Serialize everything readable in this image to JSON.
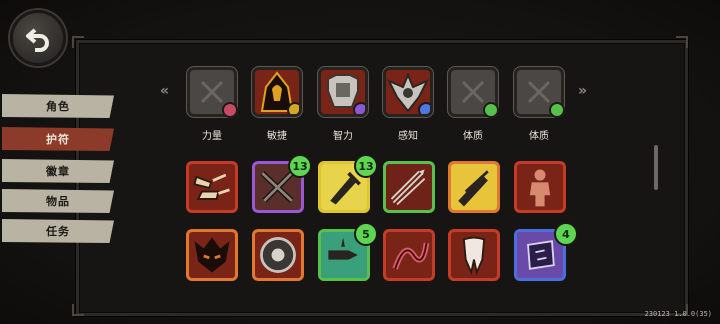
{
  "nav": {
    "back_icon": "back-arrow-icon",
    "tabs": [
      {
        "label": "角色",
        "active": false
      },
      {
        "label": "护符",
        "active": true
      },
      {
        "label": "徽章",
        "active": false
      },
      {
        "label": "物品",
        "active": false
      },
      {
        "label": "任务",
        "active": false
      }
    ]
  },
  "equip_slots": [
    {
      "label": "力量",
      "state": "empty",
      "badge_color": "#c94a63"
    },
    {
      "label": "敏捷",
      "state": "filled",
      "badge_color": "#d4a726"
    },
    {
      "label": "智力",
      "state": "filled",
      "badge_color": "#8a58d6"
    },
    {
      "label": "感知",
      "state": "filled",
      "badge_color": "#4c78e0"
    },
    {
      "label": "体质",
      "state": "empty",
      "badge_color": "#58c14c"
    },
    {
      "label": "体质",
      "state": "empty",
      "badge_color": "#58c14c"
    }
  ],
  "relics": [
    {
      "icon": "claw-hands-icon",
      "rarity": "red",
      "count": null
    },
    {
      "icon": "crossed-rifles-icon",
      "rarity": "purple",
      "count": "13"
    },
    {
      "icon": "sword-hilt-icon",
      "rarity": "yellow",
      "count": "13"
    },
    {
      "icon": "arrow-bundle-icon",
      "rarity": "green",
      "count": null
    },
    {
      "icon": "twin-daggers-icon",
      "rarity": "orange",
      "count": null
    },
    {
      "icon": "humanoid-figure-icon",
      "rarity": "red",
      "count": null
    },
    {
      "icon": "demon-mask-icon",
      "rarity": "orange",
      "count": null
    },
    {
      "icon": "ward-medallion-icon",
      "rarity": "orange",
      "count": null
    },
    {
      "icon": "bullet-icon",
      "rarity": "green",
      "count": "5"
    },
    {
      "icon": "tentacle-icon",
      "rarity": "red",
      "count": null
    },
    {
      "icon": "fang-icon",
      "rarity": "red",
      "count": null
    },
    {
      "icon": "rune-shield-icon",
      "rarity": "blue",
      "count": "4"
    }
  ],
  "version": "230123 1.0.0(35)",
  "colors": {
    "active_tab": "#8c3a2a",
    "inactive_tab": "#b9b3a3",
    "count_badge": "#5fd651"
  }
}
